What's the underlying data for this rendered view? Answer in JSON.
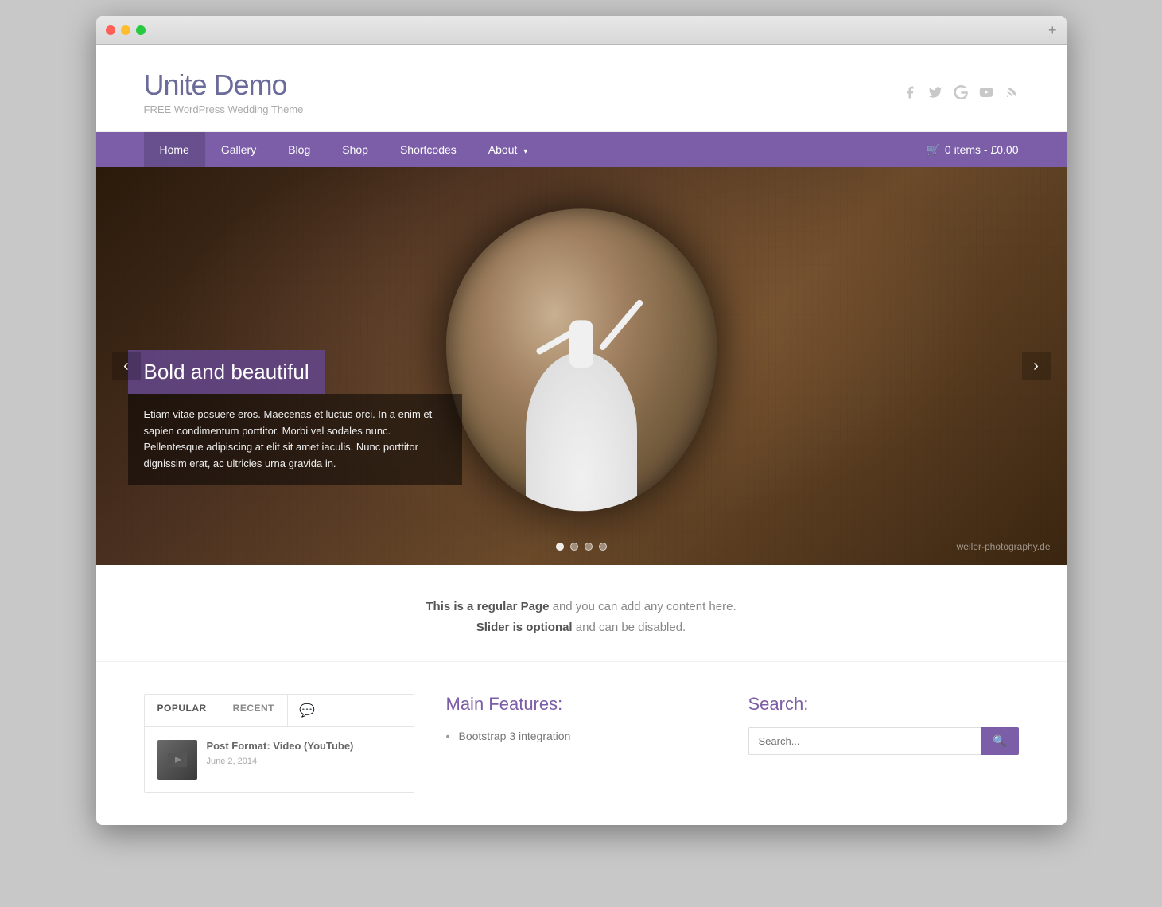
{
  "browser": {
    "plus_label": "+"
  },
  "site": {
    "title": "Unite Demo",
    "tagline": "FREE WordPress Wedding Theme"
  },
  "social": {
    "icons": [
      "facebook",
      "twitter",
      "google-plus",
      "youtube",
      "rss"
    ]
  },
  "nav": {
    "items": [
      {
        "label": "Home",
        "active": true
      },
      {
        "label": "Gallery",
        "active": false
      },
      {
        "label": "Blog",
        "active": false
      },
      {
        "label": "Shop",
        "active": false
      },
      {
        "label": "Shortcodes",
        "active": false
      },
      {
        "label": "About",
        "active": false,
        "has_dropdown": true
      }
    ],
    "cart_label": "0 items - £0.00"
  },
  "slider": {
    "caption_title": "Bold and beautiful",
    "caption_text": "Etiam vitae posuere eros. Maecenas et luctus orci. In a enim et sapien condimentum porttitor. Morbi vel sodales nunc. Pellentesque adipiscing at elit sit amet iaculis. Nunc porttitor dignissim erat, ac ultricies urna gravida in.",
    "arrow_left": "‹",
    "arrow_right": "›",
    "watermark": "weiler-photography.de",
    "dots": [
      true,
      false,
      false,
      false
    ]
  },
  "page_desc": {
    "line1_bold": "This is a regular Page",
    "line1_rest": " and you can add any content here.",
    "line2_bold": "Slider is optional",
    "line2_rest": " and can be disabled."
  },
  "tabs_widget": {
    "tabs": [
      "POPULAR",
      "RECENT"
    ],
    "icon": "💬",
    "post_title": "Post Format: Video (YouTube)",
    "post_date": "June 2, 2014"
  },
  "features": {
    "title": "Main Features:",
    "items": [
      "Bootstrap 3 integration"
    ]
  },
  "search": {
    "title": "Search:",
    "placeholder": "Search...",
    "button_icon": "🔍"
  }
}
